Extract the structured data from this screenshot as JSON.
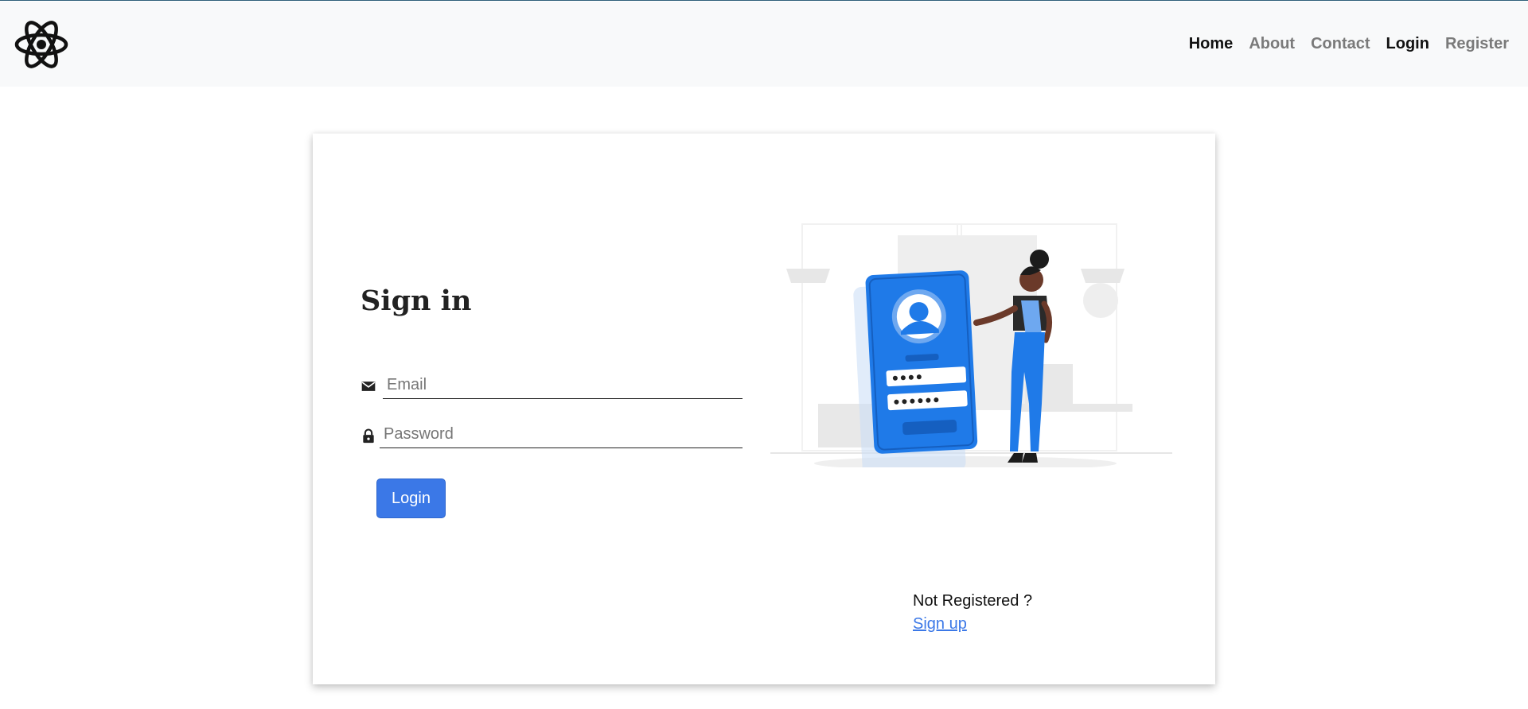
{
  "nav": {
    "logo_icon": "atom-icon",
    "links": [
      "Home",
      "About",
      "Contact",
      "Login",
      "Register"
    ]
  },
  "login": {
    "title": "Sign in",
    "email_placeholder": "Email",
    "password_placeholder": "Password",
    "email_icon": "envelope-icon",
    "password_icon": "lock-icon",
    "button_label": "Login",
    "not_registered_text": "Not Registered ?",
    "signup_link_text": "Sign up"
  },
  "colors": {
    "accent": "#3b78e7",
    "illustration_blue": "#1f7ae8",
    "navbar_bg": "#f8f9fa"
  }
}
